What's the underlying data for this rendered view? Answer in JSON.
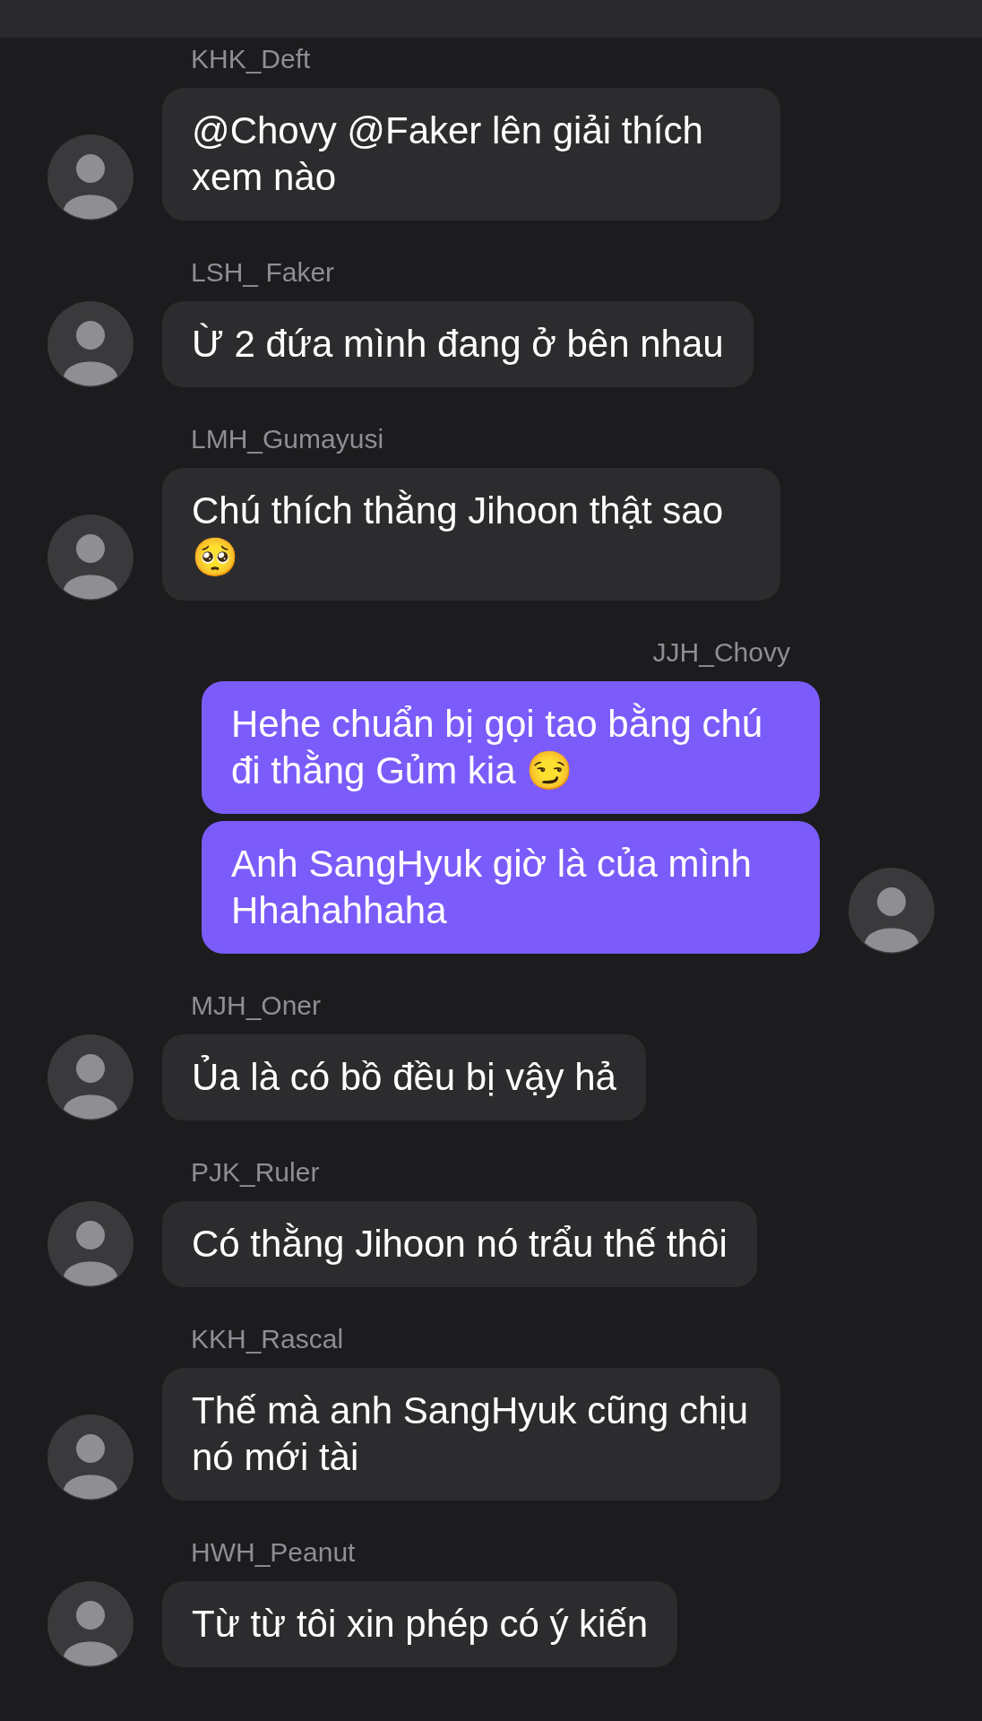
{
  "messages": [
    {
      "sender": "KHK_Deft",
      "outgoing": false,
      "bubbles": [
        "@Chovy @Faker lên giải thích xem nào"
      ]
    },
    {
      "sender": "LSH_ Faker",
      "outgoing": false,
      "bubbles": [
        "Ừ 2 đứa mình đang ở bên nhau"
      ]
    },
    {
      "sender": "LMH_Gumayusi",
      "outgoing": false,
      "bubbles": [
        "Chú thích thằng Jihoon thật sao 🥺"
      ]
    },
    {
      "sender": "JJH_Chovy",
      "outgoing": true,
      "bubbles": [
        "Hehe chuẩn bị gọi tao bằng chú đi thằng Gủm kia 😏",
        "Anh SangHyuk giờ là của mình Hhahahhaha"
      ]
    },
    {
      "sender": "MJH_Oner",
      "outgoing": false,
      "bubbles": [
        "Ủa là có bồ đều bị vậy hả"
      ]
    },
    {
      "sender": "PJK_Ruler",
      "outgoing": false,
      "bubbles": [
        "Có thằng Jihoon nó trẩu thế thôi"
      ]
    },
    {
      "sender": "KKH_Rascal",
      "outgoing": false,
      "bubbles": [
        "Thế mà anh SangHyuk cũng chịu nó mới tài"
      ]
    },
    {
      "sender": "HWH_Peanut",
      "outgoing": false,
      "bubbles": [
        "Từ từ tôi xin phép có ý kiến"
      ]
    }
  ]
}
